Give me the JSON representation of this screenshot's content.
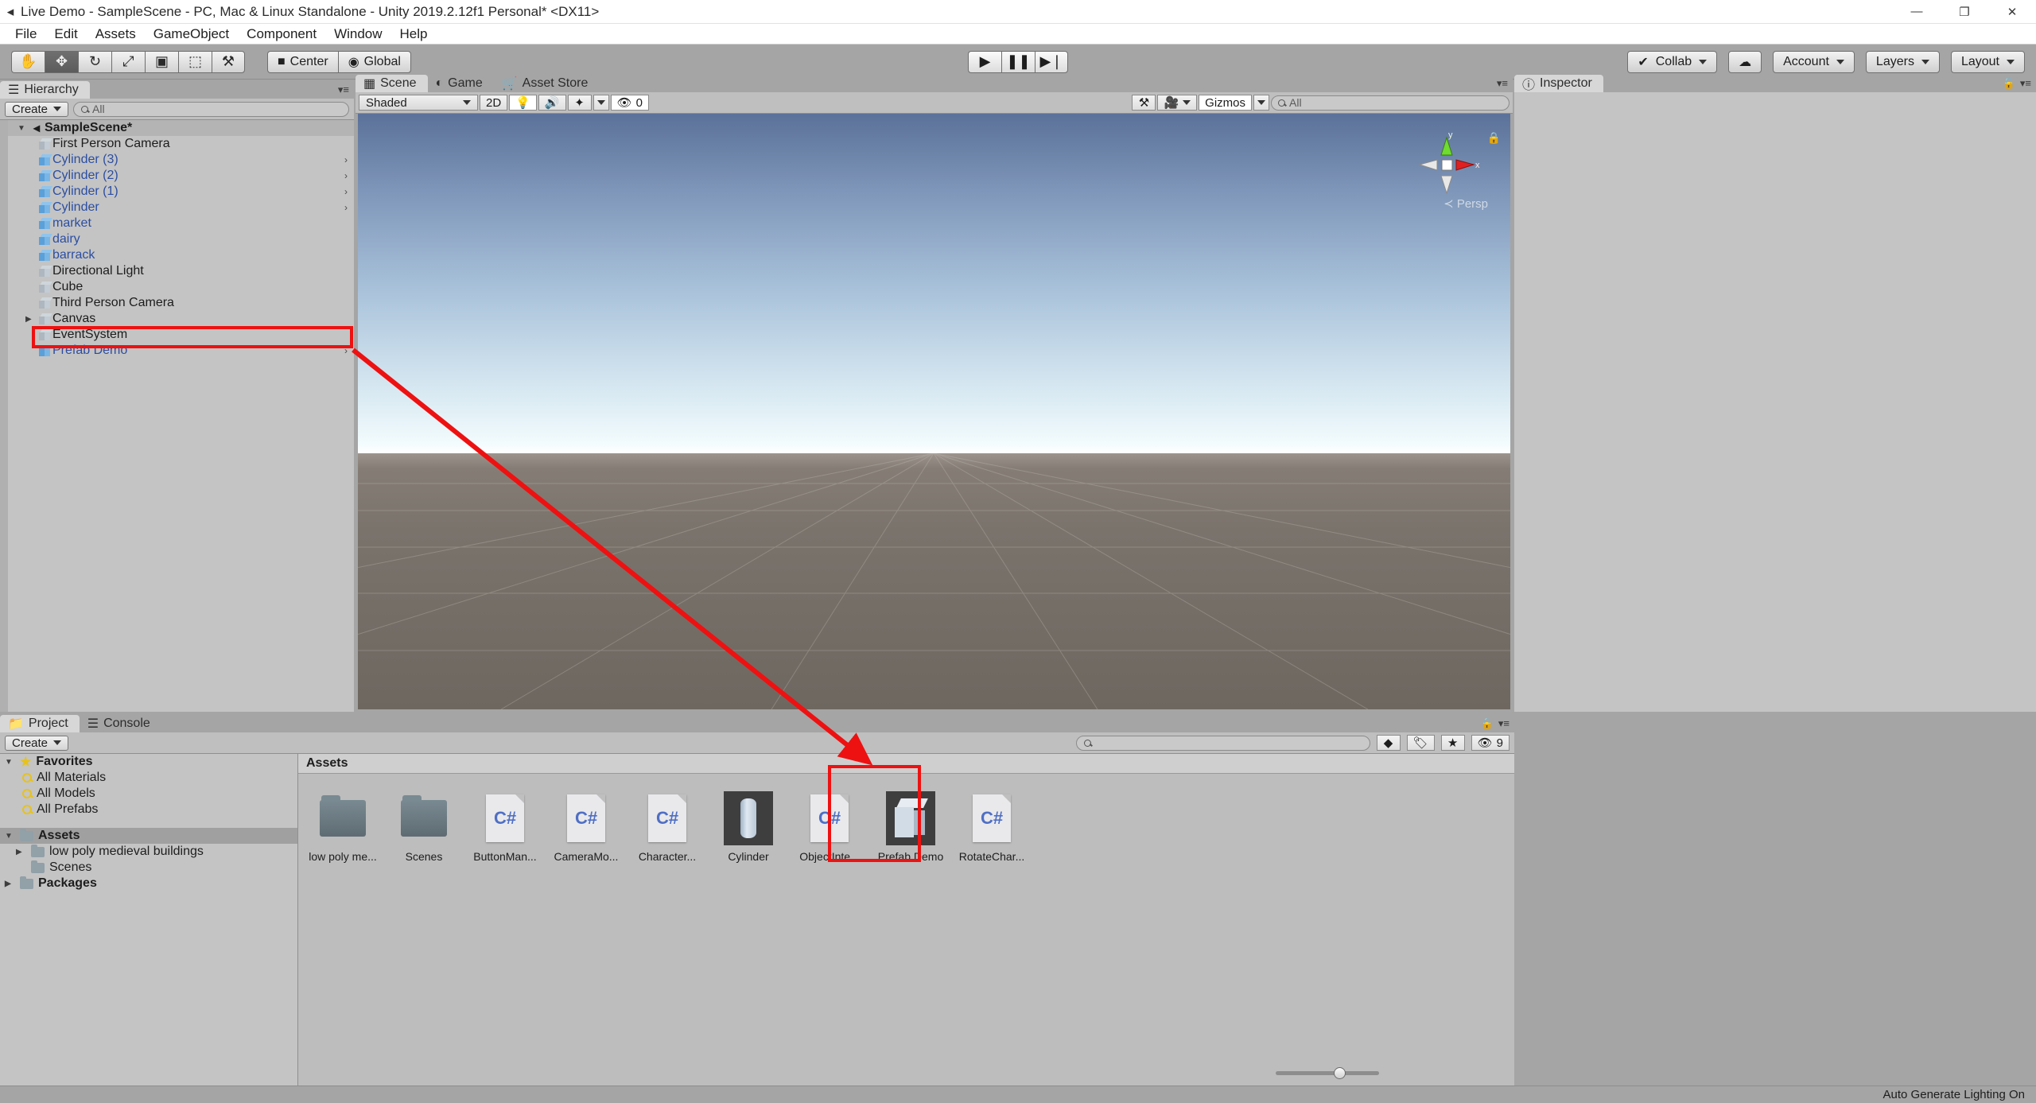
{
  "window": {
    "title": "Live Demo - SampleScene - PC, Mac & Linux Standalone - Unity 2019.2.12f1 Personal* <DX11>",
    "app_icon": "unity-icon",
    "minimize": "—",
    "maximize": "❐",
    "close": "✕"
  },
  "menu": {
    "items": [
      "File",
      "Edit",
      "Assets",
      "GameObject",
      "Component",
      "Window",
      "Help"
    ]
  },
  "toolbar": {
    "tools": [
      {
        "name": "hand-tool",
        "glyph": "✋",
        "active": false
      },
      {
        "name": "move-tool",
        "glyph": "✥",
        "active": true
      },
      {
        "name": "rotate-tool",
        "glyph": "↻",
        "active": false
      },
      {
        "name": "scale-tool",
        "glyph": "⤢",
        "active": false
      },
      {
        "name": "rect-tool",
        "glyph": "▣",
        "active": false
      },
      {
        "name": "transform-tool",
        "glyph": "⬚",
        "active": false
      },
      {
        "name": "custom-tool",
        "glyph": "⚒",
        "active": false
      }
    ],
    "pivot_mode": "Center",
    "pivot_rotation": "Global",
    "play": "▶",
    "pause": "❚❚",
    "step": "▶❘",
    "collab": "Collab",
    "cloud_icon": "cloud-icon",
    "account": "Account",
    "layers": "Layers",
    "layout": "Layout"
  },
  "hierarchy": {
    "tab": "Hierarchy",
    "create": "Create",
    "search_placeholder": "All",
    "scene_name": "SampleScene*",
    "items": [
      {
        "label": "First Person Camera",
        "type": "gameobject",
        "prefab": false,
        "expandable": false,
        "has_arrow": false
      },
      {
        "label": "Cylinder (3)",
        "type": "prefab",
        "prefab": true,
        "expandable": false,
        "has_arrow": true
      },
      {
        "label": "Cylinder (2)",
        "type": "prefab",
        "prefab": true,
        "expandable": false,
        "has_arrow": true
      },
      {
        "label": "Cylinder (1)",
        "type": "prefab",
        "prefab": true,
        "expandable": false,
        "has_arrow": true
      },
      {
        "label": "Cylinder",
        "type": "prefab",
        "prefab": true,
        "expandable": false,
        "has_arrow": true
      },
      {
        "label": "market",
        "type": "model",
        "prefab": true,
        "expandable": false,
        "has_arrow": false
      },
      {
        "label": "dairy",
        "type": "model",
        "prefab": true,
        "expandable": false,
        "has_arrow": false
      },
      {
        "label": "barrack",
        "type": "model",
        "prefab": true,
        "expandable": false,
        "has_arrow": false
      },
      {
        "label": "Directional Light",
        "type": "gameobject",
        "prefab": false,
        "expandable": false,
        "has_arrow": false
      },
      {
        "label": "Cube",
        "type": "gameobject",
        "prefab": false,
        "expandable": false,
        "has_arrow": false
      },
      {
        "label": "Third Person Camera",
        "type": "gameobject",
        "prefab": false,
        "expandable": false,
        "has_arrow": false
      },
      {
        "label": "Canvas",
        "type": "gameobject",
        "prefab": false,
        "expandable": true,
        "has_arrow": false
      },
      {
        "label": "EventSystem",
        "type": "gameobject",
        "prefab": false,
        "expandable": false,
        "has_arrow": false
      },
      {
        "label": "Prefab Demo",
        "type": "prefab",
        "prefab": true,
        "expandable": false,
        "has_arrow": true,
        "highlighted": true
      }
    ]
  },
  "scene": {
    "tabs": [
      {
        "label": "Scene",
        "icon": "grid-icon",
        "active": true
      },
      {
        "label": "Game",
        "icon": "gamepad-icon",
        "active": false
      },
      {
        "label": "Asset Store",
        "icon": "store-icon",
        "active": false
      }
    ],
    "draw_mode": "Shaded",
    "mode_2d": "2D",
    "lighting_icon": "lightbulb-icon",
    "audio_icon": "speaker-icon",
    "effects_icon": "effects-icon",
    "hidden_count": "0",
    "tools_icon": "tools-icon",
    "camera_icon": "camera-icon",
    "gizmos": "Gizmos",
    "search_placeholder": "All",
    "gizmo_axis_x": "x",
    "gizmo_axis_y": "y",
    "projection": "Persp",
    "lock_icon": "lock-icon"
  },
  "inspector": {
    "tab": "Inspector",
    "icon": "info-icon",
    "lock_icon": "lock-icon",
    "menu_icon": "menu-icon"
  },
  "project": {
    "tabs": [
      {
        "label": "Project",
        "icon": "folder-icon",
        "active": true
      },
      {
        "label": "Console",
        "icon": "console-icon",
        "active": false
      }
    ],
    "create": "Create",
    "search_placeholder": "",
    "filter_icons": [
      "shapes-filter-icon",
      "label-filter-icon",
      "star-filter-icon"
    ],
    "hidden_count": "9",
    "tree": [
      {
        "label": "Favorites",
        "icon": "star-icon",
        "bold": true,
        "twisty": "▼",
        "indent": 0
      },
      {
        "label": "All Materials",
        "icon": "search-icon",
        "bold": false,
        "twisty": "",
        "indent": 1
      },
      {
        "label": "All Models",
        "icon": "search-icon",
        "bold": false,
        "twisty": "",
        "indent": 1
      },
      {
        "label": "All Prefabs",
        "icon": "search-icon",
        "bold": false,
        "twisty": "",
        "indent": 1
      },
      {
        "label": "Assets",
        "icon": "folder-icon",
        "bold": true,
        "twisty": "▼",
        "indent": 0,
        "selected": true
      },
      {
        "label": "low poly medieval buildings",
        "icon": "folder-icon",
        "bold": false,
        "twisty": "▶",
        "indent": 1
      },
      {
        "label": "Scenes",
        "icon": "folder-icon",
        "bold": false,
        "twisty": "",
        "indent": 1
      },
      {
        "label": "Packages",
        "icon": "folder-icon",
        "bold": true,
        "twisty": "▶",
        "indent": 0
      }
    ],
    "breadcrumb": "Assets",
    "assets": [
      {
        "label": "low poly me...",
        "kind": "folder"
      },
      {
        "label": "Scenes",
        "kind": "folder"
      },
      {
        "label": "ButtonMan...",
        "kind": "script",
        "badge": "C#"
      },
      {
        "label": "CameraMo...",
        "kind": "script",
        "badge": "C#"
      },
      {
        "label": "Character...",
        "kind": "script",
        "badge": "C#"
      },
      {
        "label": "Cylinder",
        "kind": "mesh"
      },
      {
        "label": "ObjectInte...",
        "kind": "script",
        "badge": "C#"
      },
      {
        "label": "Prefab Demo",
        "kind": "prefab",
        "highlighted": true
      },
      {
        "label": "RotateChar...",
        "kind": "script",
        "badge": "C#"
      }
    ]
  },
  "statusbar": {
    "message": "Auto Generate Lighting On"
  },
  "annotation": {
    "color": "#ee1111",
    "description": "arrow from Prefab Demo hierarchy entry to Prefab Demo asset"
  }
}
